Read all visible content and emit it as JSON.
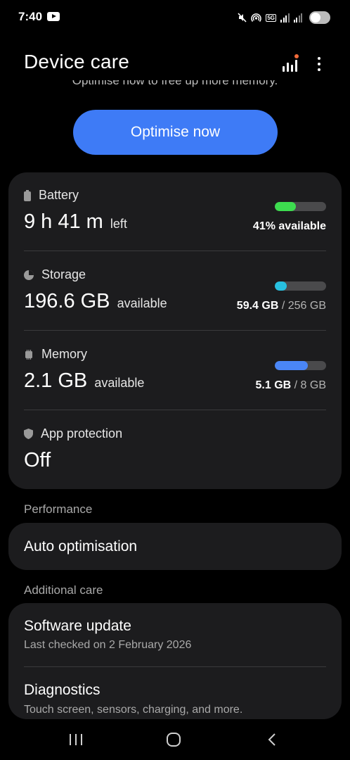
{
  "status_bar": {
    "time": "7:40"
  },
  "header": {
    "title": "Device care"
  },
  "optimise": {
    "subtext": "Optimise now to free up more memory.",
    "button_label": "Optimise now"
  },
  "stats": {
    "battery": {
      "label": "Battery",
      "value": "9 h 41 m",
      "unit": "left",
      "right_text": "41% available",
      "level": 0.41,
      "color": "#3ddc4f"
    },
    "storage": {
      "label": "Storage",
      "value": "196.6 GB",
      "unit": "available",
      "used": "59.4 GB",
      "total": "/ 256 GB",
      "level": 0.23,
      "color": "#27c0e0"
    },
    "memory": {
      "label": "Memory",
      "value": "2.1 GB",
      "unit": "available",
      "used": "5.1 GB",
      "total": "/ 8 GB",
      "level": 0.64,
      "color": "#4a86f7"
    },
    "app_protection": {
      "label": "App protection",
      "value": "Off"
    }
  },
  "performance": {
    "section_label": "Performance",
    "auto_optimisation": "Auto optimisation"
  },
  "additional_care": {
    "section_label": "Additional care",
    "software_update": {
      "title": "Software update",
      "subtitle": "Last checked on 2 February 2026"
    },
    "diagnostics": {
      "title": "Diagnostics",
      "subtitle": "Touch screen, sensors, charging, and more."
    }
  }
}
